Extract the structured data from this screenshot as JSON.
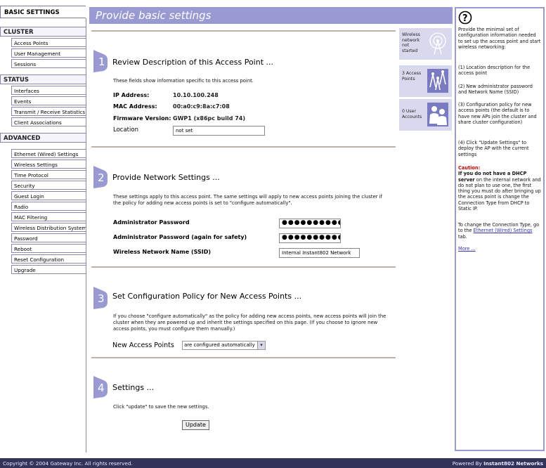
{
  "nav": {
    "active": "BASIC SETTINGS",
    "cluster": {
      "header": "CLUSTER",
      "items": [
        "Access Points",
        "User Management",
        "Sessions"
      ]
    },
    "status": {
      "header": "STATUS",
      "items": [
        "Interfaces",
        "Events",
        "Transmit / Receive Statistics",
        "Client Associations"
      ]
    },
    "advanced": {
      "header": "ADVANCED",
      "items": [
        "Ethernet (Wired) Settings",
        "Wireless Settings",
        "Time Protocol",
        "Security",
        "Guest Login",
        "Radio",
        "MAC Filtering",
        "Wireless Distribution System",
        "Password",
        "Reboot",
        "Reset Configuration",
        "Upgrade"
      ]
    }
  },
  "main": {
    "title": "Provide basic settings",
    "s1": {
      "number": "1",
      "title": "Review Description of this Access Point ...",
      "desc": "These fields show information specific to this access point.",
      "ip_label": "IP Address:",
      "ip_value": "10.10.100.248",
      "mac_label": "MAC Address:",
      "mac_value": "00:a0:c9:8a:c7:08",
      "fw_label": "Firmware Version:",
      "fw_value": "GWP1 (x86pc build 74)",
      "loc_label": "Location",
      "loc_value": "not set"
    },
    "s2": {
      "number": "2",
      "title": "Provide Network Settings ...",
      "desc": "These settings apply to this access point. The same settings will apply to new access points joining the cluster if the policy for adding new access points is set to \"configure automatically\".",
      "pwd_label": "Administrator Password",
      "pwd_value": "●●●●●●●●●●●",
      "pwd2_label": "Administrator Password (again for safety)",
      "pwd2_value": "●●●●●●●●●●●",
      "ssid_label": "Wireless Network Name (SSID)",
      "ssid_value": "Internal Instant802 Network"
    },
    "s3": {
      "number": "3",
      "title": "Set Configuration Policy for New Access Points ...",
      "desc": "If you choose \"configure automatically\" as the policy for adding new access points, new access points will join the cluster when they are powered up and inherit the settings specified on this page. (If you choose to ignore new access points, you must configure them manually.)",
      "policy_label": "New Access Points",
      "policy_value": "are configured automatically"
    },
    "s4": {
      "number": "4",
      "title": "Settings ...",
      "desc": "Click \"update\" to save the new settings.",
      "button": "Update"
    }
  },
  "tiles": [
    {
      "text": "Wireless network not started",
      "icon": "radio-tower-icon"
    },
    {
      "text": "3 Access Points",
      "icon": "access-points-icon"
    },
    {
      "text": "0 User Accounts",
      "icon": "users-icon"
    }
  ],
  "help": {
    "icon": "?",
    "intro": "Provide the minimal set of configuration information needed to set up the access point and start wireless networking:",
    "p1": "(1) Location description for the access point",
    "p2": "(2) New administrator password and Network Name (SSID)",
    "p3": "(3) Configuration policy for new access points (the default is to have new APs join the cluster and share cluster configuration)",
    "p4": "(4) Click \"Update Settings\" to deploy the AP with the current settings",
    "caution_label": "Caution:",
    "caution_bold": "If you do not have a DHCP server",
    "caution_rest": "on the internal network and do not plan to use one, the first thing you must do after bringing up the access point is change the Connection Type from DHCP to Static IP.",
    "change_text": "To change the Connection Type, go to the",
    "change_link": "Ethernet (Wired) Settings",
    "change_tail": "tab.",
    "more": "More ..."
  },
  "footer": {
    "copyright": "Copyright © 2004 Gateway Inc. All rights reserved.",
    "powered_prefix": "Powered By",
    "powered_brand": "Instant802 Networks"
  },
  "colors": {
    "accent": "#9a9ad2",
    "tile": "#d9d9ee",
    "footer": "#33335a",
    "caution": "#cc0000",
    "link": "#3333aa"
  }
}
